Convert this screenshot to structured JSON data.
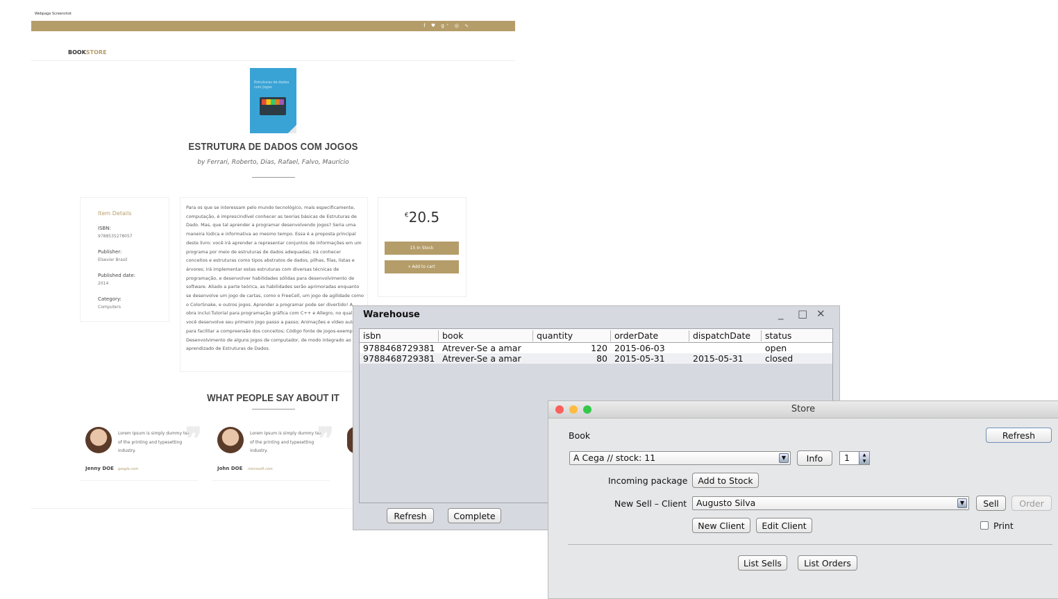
{
  "webpage": {
    "caption": "Webpage Screenshot",
    "social_icons": "f ♥ g⁺ ◎ ∿",
    "logo_bold": "BOOK",
    "logo_accent": "STORE",
    "book": {
      "cover_text": "Estruturas de dados com Jogos",
      "title": "ESTRUTURA DE DADOS COM JOGOS",
      "authors": "by Ferrari, Roberto, Dias, Rafael, Falvo, Maurício"
    },
    "details": {
      "heading": "Item Details",
      "isbn_label": "ISBN:",
      "isbn": "9788535278057",
      "publisher_label": "Publisher:",
      "publisher": "Elsevier Brasil",
      "published_label": "Published date:",
      "published": "2014",
      "category_label": "Category:",
      "category": "Computers"
    },
    "description": "Para os que se interessam pelo mundo tecnológico, mais especificamente, computação, é imprescindível conhecer as teorias básicas de Estruturas de Dado. Mas, que tal aprender a programar desenvolvendo jogos? Seria uma maneira lúdica e informativa ao mesmo tempo. Essa é a proposta principal deste livro: você irá aprender a representar conjuntos de informações em um programa por meio de estruturas de dados adequadas; irá conhecer conceitos e estruturas como tipos abstratos de dados, pilhas, filas, listas e árvores; irá implementar estas estruturas com diversas técnicas de programação, e desenvolver habilidades sólidas para desenvolvimento de software. Aliado a parte teórica, as habilidades serão aprimoradas enquanto se desenvolve um jogo de cartas, como o FreeCell, um jogo de agilidade como o ColorSnake, e outros jogos. Aprender a programar pode ser divertido! A obra inclui:Tutorial para programação gráfica com C++ e Allegro, no qual você desenvolve seu primeiro jogo passo a passo; Animações e vídeo aulas para facilitar a compreensão dos conceitos; Código fonte de jogos-exemplo; Desenvolvimento de alguns jogos de computador, de modo integrado ao aprendizado de Estruturas de Dados.",
    "price_currency": "€",
    "price": "20.5",
    "stock_button": "15 In Stock",
    "cart_button": "⊧ Add to cart",
    "testimonials_heading": "WHAT PEOPLE SAY ABOUT IT",
    "testimonials": [
      {
        "text": "Lorem Ipsum is simply dummy text of the printing and typesetting industry.",
        "name": "Jenny DOE",
        "site": "google.com"
      },
      {
        "text": "Lorem Ipsum is simply dummy text of the printing and typesetting industry.",
        "name": "John DOE",
        "site": "microsoft.com"
      }
    ]
  },
  "warehouse": {
    "title": "Warehouse",
    "controls": {
      "minimize": "_",
      "maximize": "□",
      "close": "✕"
    },
    "columns": [
      "isbn",
      "book",
      "quantity",
      "orderDate",
      "dispatchDate",
      "status"
    ],
    "rows": [
      [
        "9788468729381",
        "Atrever-Se a amar",
        "120",
        "2015-06-03",
        "",
        "open"
      ],
      [
        "9788468729381",
        "Atrever-Se a amar",
        "80",
        "2015-05-31",
        "2015-05-31",
        "closed"
      ]
    ],
    "refresh_button": "Refresh",
    "complete_button": "Complete"
  },
  "store": {
    "title": "Store",
    "book_label": "Book",
    "refresh_button": "Refresh",
    "book_select": "A Cega // stock: 11",
    "info_button": "Info",
    "quantity": "1",
    "incoming_label": "Incoming package",
    "add_stock_button": "Add to Stock",
    "new_sell_label": "New Sell – Client",
    "client_select": "Augusto Silva",
    "sell_button": "Sell",
    "order_button": "Order",
    "new_client_button": "New Client",
    "edit_client_button": "Edit Client",
    "print_label": "Print",
    "list_sells_button": "List Sells",
    "list_orders_button": "List Orders",
    "traffic_colors": {
      "close": "#fc605c",
      "minimize": "#fdbc40",
      "zoom": "#34c84a"
    }
  }
}
